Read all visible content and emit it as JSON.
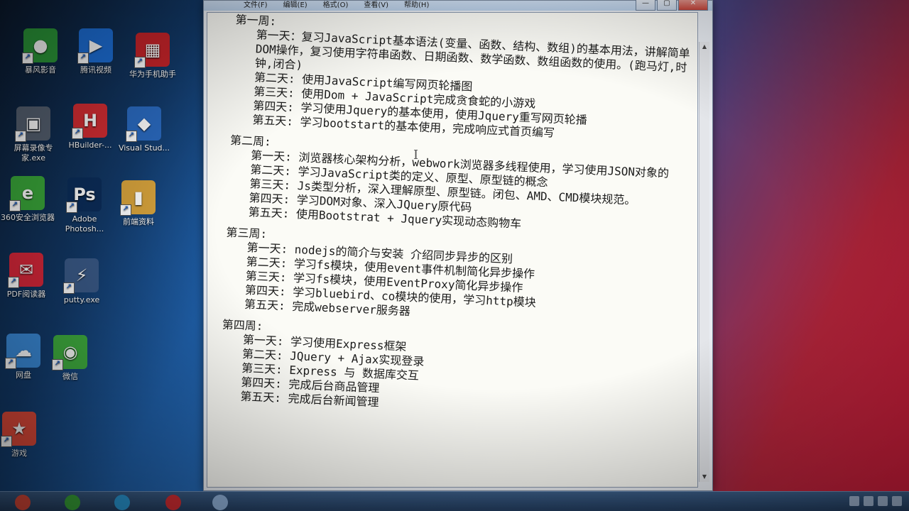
{
  "desktop": {
    "icons": [
      {
        "name": "icon-storm",
        "label": "暴风影音",
        "glyph": "●",
        "color": "#2c9a3a"
      },
      {
        "name": "icon-tencent-video",
        "label": "腾讯视频",
        "glyph": "▶",
        "color": "#1d6fd8"
      },
      {
        "name": "icon-mobile-assistant",
        "label": "华为手机助手",
        "glyph": "▦",
        "color": "#c8242a"
      },
      {
        "name": "icon-screen-recorder",
        "label": "屏幕录像专家.exe",
        "glyph": "▣",
        "color": "#556070"
      },
      {
        "name": "icon-hbuilder",
        "label": "HBuilder-...",
        "glyph": "H",
        "color": "#d42d33"
      },
      {
        "name": "icon-visual-studio",
        "label": "Visual Stud...",
        "glyph": "◆",
        "color": "#2a6ac0"
      },
      {
        "name": "icon-360-browser",
        "label": "360安全浏览器",
        "glyph": "e",
        "color": "#3aa83a"
      },
      {
        "name": "icon-photoshop",
        "label": "Adobe Photosh...",
        "glyph": "Ps",
        "color": "#0b2d5a"
      },
      {
        "name": "icon-folder",
        "label": "前端资料",
        "glyph": "▮",
        "color": "#d6a23c"
      },
      {
        "name": "icon-pdf-reader",
        "label": "PDF阅读器",
        "glyph": "✉",
        "color": "#d8273a"
      },
      {
        "name": "icon-putty",
        "label": "putty.exe",
        "glyph": "⚡",
        "color": "#3a5a88"
      },
      {
        "name": "icon-cloud",
        "label": "网盘",
        "glyph": "☁",
        "color": "#3a8ad8"
      },
      {
        "name": "icon-wechat",
        "label": "微信",
        "glyph": "◉",
        "color": "#3fae3f"
      },
      {
        "name": "icon-game",
        "label": "游戏",
        "glyph": "★",
        "color": "#e04a3a"
      }
    ]
  },
  "window": {
    "menu": [
      "文件(F)",
      "编辑(E)",
      "格式(O)",
      "查看(V)",
      "帮助(H)"
    ],
    "controls": {
      "minimize": "—",
      "maximize": "▢",
      "close": "✕"
    }
  },
  "document": {
    "weeks": [
      {
        "title": "第一周:",
        "lines": [
          {
            "text": "第一天：复习JavaScript基本语法(变量、函数、结构、数组)的基本用法，讲解简单DOM操作，复习使用字符串函数、日期函数、数学函数、数组函数的使用。(跑马灯,时钟,闭合)",
            "wrap": true
          },
          {
            "text": "第二天: 使用JavaScript编写网页轮播图"
          },
          {
            "text": "第三天: 使用Dom + JavaScript完成贪食蛇的小游戏"
          },
          {
            "text": "第四天: 学习使用Jquery的基本使用，使用Jquery重写网页轮播"
          },
          {
            "text": "第五天: 学习bootstart的基本使用，完成响应式首页编写"
          }
        ]
      },
      {
        "title": "第二周:",
        "lines": [
          {
            "text": "第一天: 浏览器核心架构分析，webwork浏览器多线程使用，学习使用JSON对象的",
            "wrap": true
          },
          {
            "text": "第二天: 学习JavaScript类的定义、原型、原型链的概念"
          },
          {
            "text": "第三天: Js类型分析，深入理解原型、原型链。闭包、AMD、CMD模块规范。",
            "wrap": true
          },
          {
            "text": "第四天: 学习DOM对象、深入JQuery原代码"
          },
          {
            "text": "第五天: 使用Bootstrat + Jquery实现动态购物车"
          }
        ]
      },
      {
        "title": "第三周:",
        "lines": [
          {
            "text": "第一天: nodejs的简介与安装 介绍同步异步的区别"
          },
          {
            "text": "第二天: 学习fs模块，使用event事件机制简化异步操作"
          },
          {
            "text": "第三天: 学习fs模块，使用EventProxy简化异步操作"
          },
          {
            "text": "第四天: 学习bluebird、co模块的使用，学习http模块"
          },
          {
            "text": "第五天: 完成webserver服务器"
          }
        ]
      },
      {
        "title": "第四周:",
        "lines": [
          {
            "text": "第一天: 学习使用Express框架"
          },
          {
            "text": "第二天: JQuery + Ajax实现登录"
          },
          {
            "text": "第三天: Express 与 数据库交互"
          },
          {
            "text": "第四天: 完成后台商品管理"
          },
          {
            "text": "第五天: 完成后台新闻管理"
          }
        ]
      }
    ]
  },
  "taskbar": {
    "items": [
      {
        "name": "taskbar-chrome",
        "color": "#e04a3a"
      },
      {
        "name": "taskbar-360",
        "color": "#3aa83a"
      },
      {
        "name": "taskbar-browser",
        "color": "#2a9ad8"
      },
      {
        "name": "taskbar-hbuilder",
        "color": "#d42d33"
      },
      {
        "name": "taskbar-notepad",
        "color": "#8fb0d8"
      }
    ]
  }
}
